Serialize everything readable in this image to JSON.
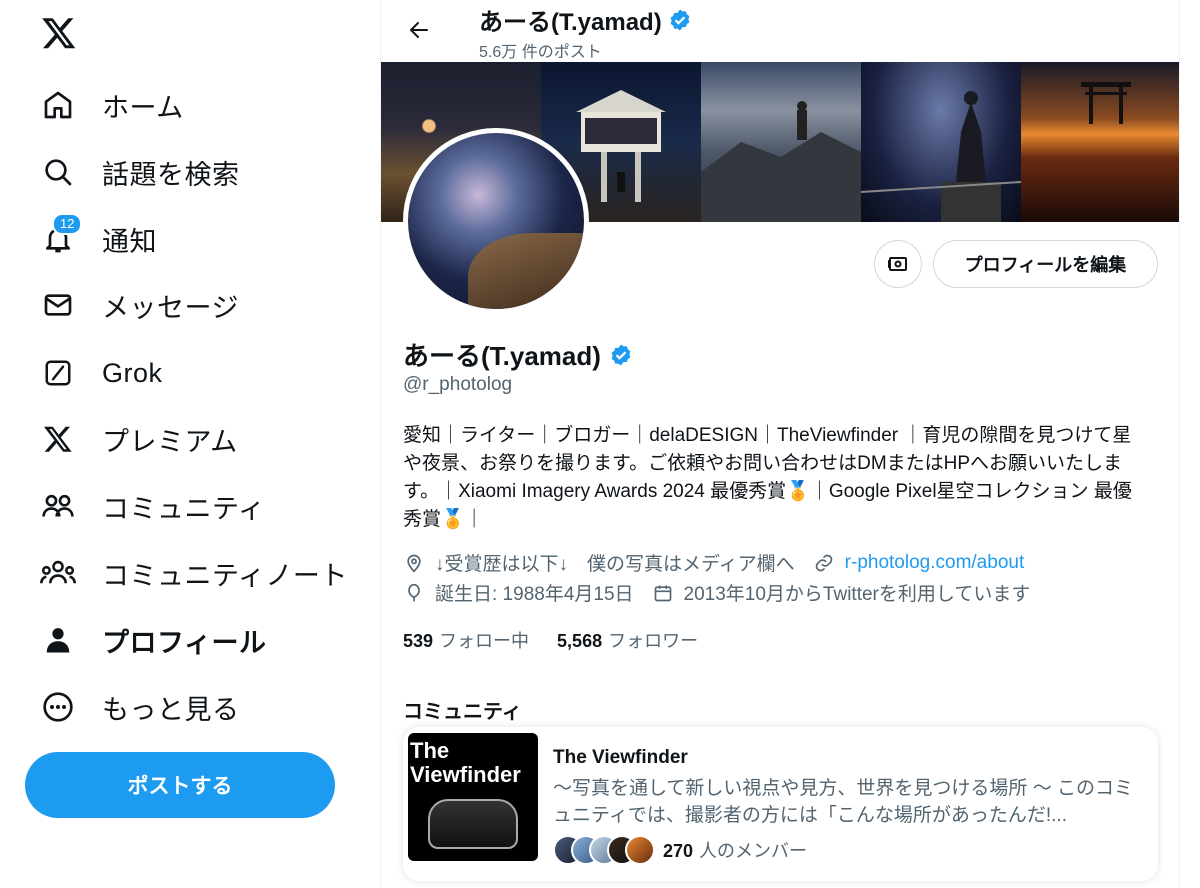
{
  "sidebar": {
    "logo": "x-logo-icon",
    "items": [
      {
        "label": "ホーム",
        "icon": "home-icon"
      },
      {
        "label": "話題を検索",
        "icon": "search-icon"
      },
      {
        "label": "通知",
        "icon": "bell-icon",
        "badge": "12"
      },
      {
        "label": "メッセージ",
        "icon": "mail-icon"
      },
      {
        "label": "Grok",
        "icon": "grok-icon"
      },
      {
        "label": "プレミアム",
        "icon": "x-logo-icon"
      },
      {
        "label": "コミュニティ",
        "icon": "community-icon"
      },
      {
        "label": "コミュニティノート",
        "icon": "community-notes-icon"
      },
      {
        "label": "プロフィール",
        "icon": "person-icon",
        "active": true
      },
      {
        "label": "もっと見る",
        "icon": "more-circle-icon"
      }
    ],
    "post_button": "ポストする"
  },
  "header": {
    "name": "あーる(T.yamad)",
    "post_count": "5.6万 件のポスト"
  },
  "profile": {
    "name": "あーる(T.yamad)",
    "handle": "@r_photolog",
    "edit_button": "プロフィールを編集",
    "bio": "愛知｜ライター｜ブロガー｜delaDESIGN｜TheViewfinder ｜育児の隙間を見つけて星や夜景、お祭りを撮ります。ご依頼やお問い合わせはDMまたはHPへお願いいたします。｜Xiaomi Imagery Awards 2024 最優秀賞🏅｜Google Pixel星空コレクション 最優秀賞🏅｜",
    "location": "↓受賞歴は以下↓　僕の写真はメディア欄へ",
    "website": "r-photolog.com/about",
    "birthday": "誕生日: 1988年4月15日",
    "joined": "2013年10月からTwitterを利用しています",
    "following_count": "539",
    "following_label": "フォロー中",
    "followers_count": "5,568",
    "followers_label": "フォロワー"
  },
  "community": {
    "section_title": "コミュニティ",
    "thumb_line1": "The",
    "thumb_line2": "Viewfinder",
    "name": "The Viewfinder",
    "description": "～写真を通して新しい視点や見方、世界を見つける場所 ～ このコミュニティでは、撮影者の方には「こんな場所があったんだ!...",
    "member_count": "270",
    "member_label": "人のメンバー"
  },
  "colors": {
    "accent": "#1d9bf0",
    "text": "#0f1419",
    "muted": "#536471"
  }
}
